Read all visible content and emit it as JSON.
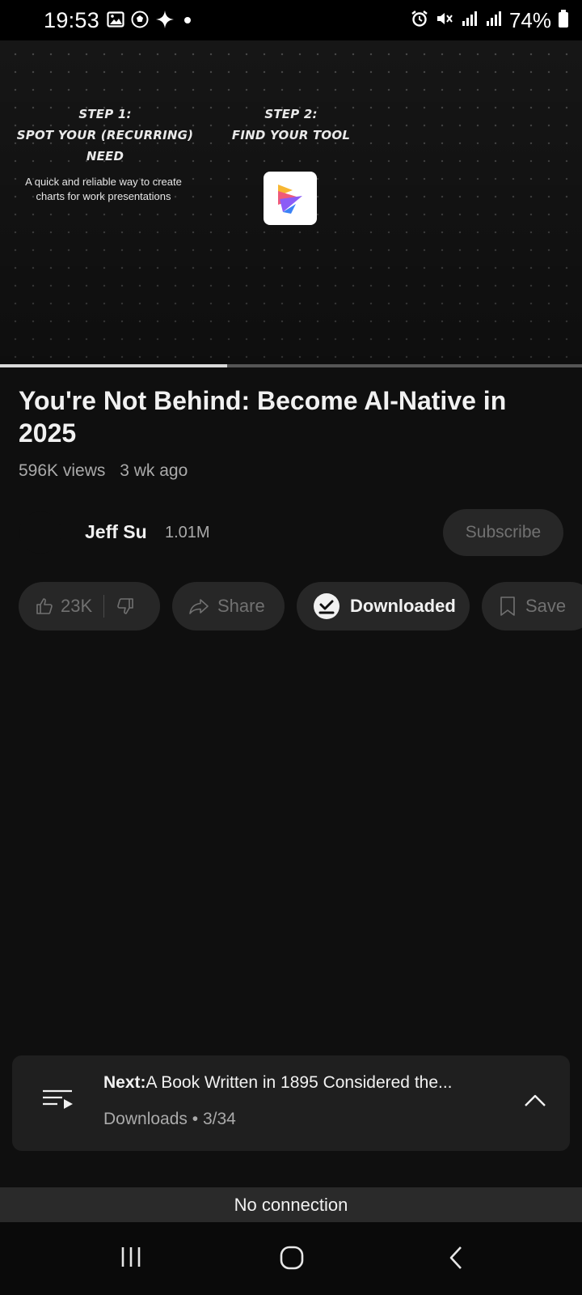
{
  "status_bar": {
    "time": "19:53",
    "battery": "74%",
    "left_icons": [
      "gallery-icon",
      "soccer-ball-icon",
      "sparkle-icon",
      "dot-icon"
    ],
    "right_icons": [
      "alarm-icon",
      "mute-icon",
      "signal-icon",
      "signal-icon",
      "battery-icon"
    ]
  },
  "video": {
    "step1_title": "STEP 1:",
    "step1_subtitle": "SPOT YOUR (RECURRING) NEED",
    "step1_desc": "A quick and reliable way to create charts for work presentations",
    "step2_title": "STEP 2:",
    "step2_subtitle": "FIND YOUR TOOL",
    "app_icon": "chart-app-icon",
    "progress": 0.39
  },
  "details": {
    "title": "You're Not Behind: Become AI-Native in 2025",
    "views": "596K views",
    "age": "3 wk ago"
  },
  "channel": {
    "name": "Jeff Su",
    "subscribers": "1.01M",
    "subscribe_label": "Subscribe"
  },
  "actions": {
    "likes": "23K",
    "share_label": "Share",
    "downloaded_label": "Downloaded",
    "save_label": "Save"
  },
  "next_up": {
    "label": "Next:",
    "title": "A Book Written in 1895 Considered the...",
    "playlist": "Downloads",
    "position": "3/34"
  },
  "banner": {
    "no_connection": "No connection"
  },
  "colors": {
    "background": "#0f0f0f",
    "pill": "#272727",
    "muted_text": "#aaaaaa",
    "disabled_text": "#717171"
  }
}
